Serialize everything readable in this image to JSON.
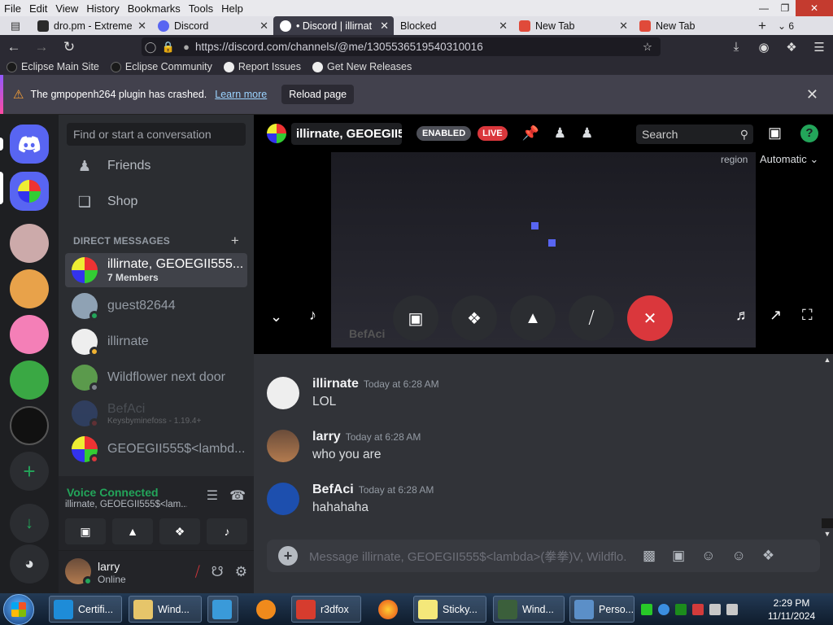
{
  "menubar": {
    "items": [
      "File",
      "Edit",
      "View",
      "History",
      "Bookmarks",
      "Tools",
      "Help"
    ]
  },
  "tabs": [
    {
      "label": "dro.pm - Extreme",
      "color": "#2a2a2a"
    },
    {
      "label": "Discord",
      "color": "#5865f2"
    },
    {
      "label": "• Discord | illirnat",
      "color": "#ffffff"
    },
    {
      "label": "Blocked",
      "color": ""
    },
    {
      "label": "New Tab",
      "color": "#e04a3a"
    },
    {
      "label": "New Tab",
      "color": "#e04a3a"
    }
  ],
  "tab_count": "6",
  "url": "https://discord.com/channels/@me/1305536519540310016",
  "bookmarks": [
    "Eclipse Main Site",
    "Eclipse Community",
    "Report Issues",
    "Get New Releases"
  ],
  "notification": {
    "message": "The gmpopenh264 plugin has crashed.",
    "learn_more": "Learn more",
    "reload": "Reload page"
  },
  "sidebar": {
    "search_placeholder": "Find or start a conversation",
    "friends": "Friends",
    "shop": "Shop",
    "dm_header": "DIRECT MESSAGES",
    "dms": [
      {
        "name": "illirnate, GEOEGII555...",
        "sub": "7 Members",
        "status": "",
        "selected": true
      },
      {
        "name": "guest82644",
        "sub": "",
        "status": "#23a55a"
      },
      {
        "name": "illirnate",
        "sub": "",
        "status": "#f0b232"
      },
      {
        "name": "Wildflower next door",
        "sub": "",
        "status": "#80848e"
      },
      {
        "name": "BefAci",
        "sub": "Keysbyminefoss - 1.19.4+",
        "status": "#da373c"
      },
      {
        "name": "GEOEGII555$<lambd...",
        "sub": "",
        "status": "#da373c"
      }
    ]
  },
  "voice": {
    "status": "Voice Connected",
    "channel": "illirnate, GEOEGII555$<lam..."
  },
  "user": {
    "name": "larry",
    "status": "Online"
  },
  "call": {
    "title": "illirnate, GEOEGII5",
    "enabled": "ENABLED",
    "live": "LIVE",
    "search": "Search",
    "region_label": "region",
    "region_value": "Automatic",
    "stream_label": "BefAci"
  },
  "messages": [
    {
      "user": "illirnate",
      "time": "Today at 6:28 AM",
      "text": "LOL"
    },
    {
      "user": "larry",
      "time": "Today at 6:28 AM",
      "text": "who you are"
    },
    {
      "user": "BefAci",
      "time": "Today at 6:28 AM",
      "text": "hahahaha"
    }
  ],
  "composer_placeholder": "Message illirnate, GEOEGII555$<lambda>(拳拳)V, Wildflo...",
  "taskbar": {
    "items": [
      "Certifi...",
      "Wind...",
      "",
      "",
      "r3dfox",
      "",
      "Sticky...",
      "Wind...",
      "Perso..."
    ],
    "time": "2:29 PM",
    "date": "11/11/2024"
  }
}
